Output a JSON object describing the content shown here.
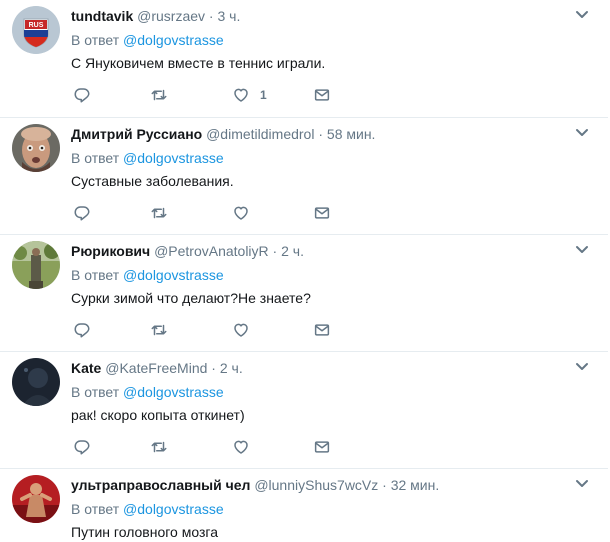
{
  "reply_prefix": "В ответ",
  "tweets": [
    {
      "name": "tundtavik",
      "handle": "@rusrzaev",
      "dot": "·",
      "time": "3 ч.",
      "reply_to": "@dolgovstrasse",
      "text": "С Януковичем вместе в теннис играли.",
      "likes": "1",
      "avatar_label": "RUS"
    },
    {
      "name": "Дмитрий Руссиано",
      "handle": "@dimetildimedrol",
      "dot": "·",
      "time": "58 мин.",
      "reply_to": "@dolgovstrasse",
      "text": "Суставные заболевания.",
      "likes": ""
    },
    {
      "name": "Рюрикович",
      "handle": "@PetrovAnatoliyR",
      "dot": "·",
      "time": "2 ч.",
      "reply_to": "@dolgovstrasse",
      "text": "Сурки зимой что делают?Не знаете?",
      "likes": ""
    },
    {
      "name": "Kate",
      "handle": "@KateFreeMind",
      "dot": "·",
      "time": "2 ч.",
      "reply_to": "@dolgovstrasse",
      "text": "рак! скоро копыта откинет)",
      "likes": ""
    },
    {
      "name": "ультраправославный чел",
      "handle": "@lunniyShus7wcVz",
      "dot": "·",
      "time": "32 мин.",
      "reply_to": "@dolgovstrasse",
      "text": "Путин головного мозга",
      "likes": ""
    }
  ],
  "colors": {
    "link": "#1b95e0",
    "muted": "#657786",
    "text": "#14171a",
    "divider": "#e6ecf0"
  },
  "icons": [
    "reply-icon",
    "retweet-icon",
    "like-icon",
    "message-icon",
    "chevron-down-icon"
  ]
}
